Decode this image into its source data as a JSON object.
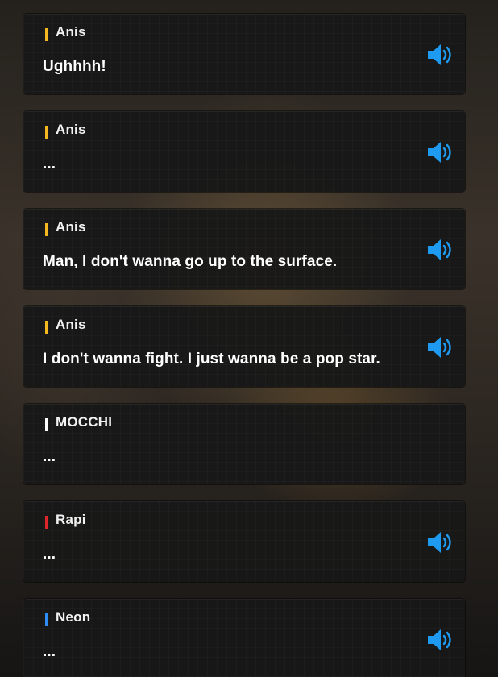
{
  "log": {
    "entries": [
      {
        "speaker": "Anis",
        "text": "Ughhhh!",
        "color": "#f5b821",
        "has_voice": true
      },
      {
        "speaker": "Anis",
        "text": "...",
        "color": "#f5b821",
        "has_voice": true
      },
      {
        "speaker": "Anis",
        "text": "Man, I don't wanna go up to the surface.",
        "color": "#f5b821",
        "has_voice": true
      },
      {
        "speaker": "Anis",
        "text": "I don't wanna fight. I just wanna be a pop star.",
        "color": "#f5b821",
        "has_voice": true
      },
      {
        "speaker": "MOCCHI",
        "text": "...",
        "color": "#ffffff",
        "has_voice": false
      },
      {
        "speaker": "Rapi",
        "text": "...",
        "color": "#e0262d",
        "has_voice": true
      },
      {
        "speaker": "Neon",
        "text": "...",
        "color": "#2f8cf0",
        "has_voice": true
      }
    ]
  },
  "icons": {
    "voice": "speaker-volume-icon"
  },
  "colors": {
    "voice_icon": "#1e9bf0",
    "card_bg": "#181818"
  }
}
